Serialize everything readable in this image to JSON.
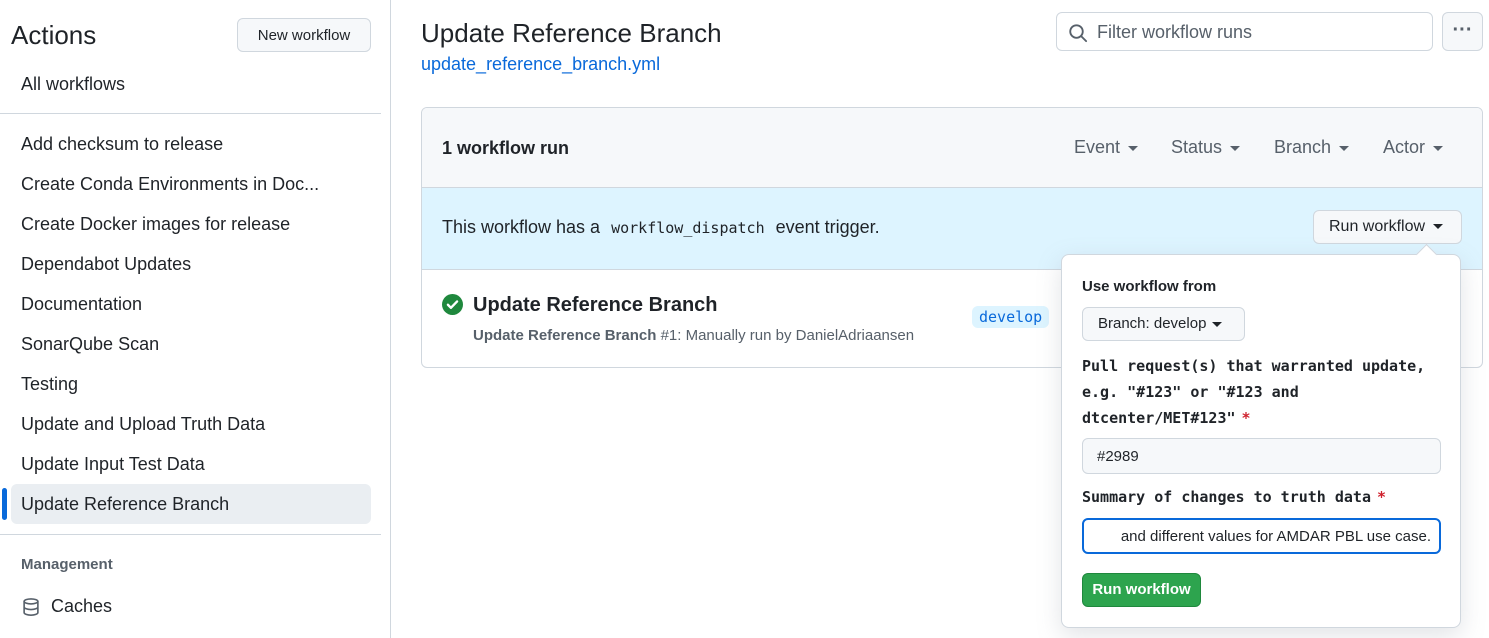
{
  "sidebar": {
    "title": "Actions",
    "new_workflow_label": "New workflow",
    "all_workflows": "All workflows",
    "items": [
      {
        "label": "Add checksum to release"
      },
      {
        "label": "Create Conda Environments in Doc..."
      },
      {
        "label": "Create Docker images for release"
      },
      {
        "label": "Dependabot Updates"
      },
      {
        "label": "Documentation"
      },
      {
        "label": "SonarQube Scan"
      },
      {
        "label": "Testing"
      },
      {
        "label": "Update and Upload Truth Data"
      },
      {
        "label": "Update Input Test Data"
      },
      {
        "label": "Update Reference Branch",
        "active": true
      }
    ],
    "management_heading": "Management",
    "caches_label": "Caches"
  },
  "header": {
    "title": "Update Reference Branch",
    "workflow_file": "update_reference_branch.yml",
    "filter_placeholder": "Filter workflow runs",
    "kebab_label": "···"
  },
  "runs": {
    "count_label": "1 workflow run",
    "filters": [
      "Event",
      "Status",
      "Branch",
      "Actor"
    ],
    "dispatch_prefix": "This workflow has a",
    "dispatch_code": "workflow_dispatch",
    "dispatch_suffix": "event trigger.",
    "run_workflow_label": "Run workflow",
    "items": [
      {
        "title": "Update Reference Branch",
        "meta_bold": "Update Reference Branch",
        "meta_rest": " #1: Manually run by DanielAdriaansen",
        "branch": "develop",
        "status": "success"
      }
    ]
  },
  "popover": {
    "use_from_label": "Use workflow from",
    "branch_label": "Branch: develop",
    "field1_label": "Pull request(s) that warranted update, e.g. \"#123\" or \"#123 and dtcenter/MET#123\"",
    "field1_value": "#2989",
    "field2_label": "Summary of changes to truth data",
    "field2_value": "and different values for AMDAR PBL use case.",
    "submit_label": "Run workflow",
    "required_mark": "*"
  },
  "colors": {
    "accent": "#0969da",
    "success": "#1f883d",
    "info_bg": "#ddf4ff",
    "required": "#cf222e"
  }
}
